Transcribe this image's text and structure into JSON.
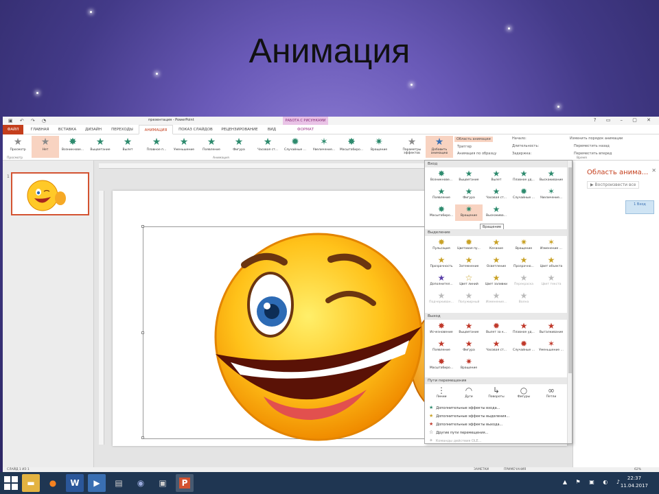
{
  "slide": {
    "title": "Анимация"
  },
  "window": {
    "doc_title": "презентация - PowerPoint",
    "context_group": "РАБОТА С РИСУНКАМИ",
    "qat_icons": [
      "save-icon",
      "undo-icon",
      "redo-icon",
      "start-icon"
    ]
  },
  "tabs": [
    {
      "label": "ФАЙЛ"
    },
    {
      "label": "ГЛАВНАЯ"
    },
    {
      "label": "ВСТАВКА"
    },
    {
      "label": "ДИЗАЙН"
    },
    {
      "label": "ПЕРЕХОДЫ"
    },
    {
      "label": "АНИМАЦИЯ"
    },
    {
      "label": "ПОКАЗ СЛАЙДОВ"
    },
    {
      "label": "РЕЦЕНЗИРОВАНИЕ"
    },
    {
      "label": "ВИД"
    },
    {
      "label": "ФОРМАТ"
    }
  ],
  "ribbon": {
    "preview": "Просмотр",
    "effects": [
      "Нет",
      "Возникнове...",
      "Выцветание",
      "Вылет",
      "Плавное п...",
      "Уменьшение",
      "Появление",
      "Фигура",
      "Часовая ст...",
      "Случайные ...",
      "Увеличение...",
      "Масштабиро...",
      "Вращение"
    ],
    "effect_params": "Параметры эффектов",
    "add_animation": "Добавить анимацию",
    "animation_pane": "Область анимации",
    "trigger": "Триггер",
    "painter": "Анимация по образцу",
    "start": "Начало:",
    "duration": "Длительность:",
    "delay": "Задержка:",
    "reorder_title": "Изменить порядок анимации",
    "move_earlier": "Переместить назад",
    "move_later": "Переместить вперед",
    "group_preview": "Просмотр",
    "group_animation": "Анимация",
    "group_timing": "Время"
  },
  "thumbnail": {
    "number": "1"
  },
  "gallery": {
    "sections": {
      "entrance": "Вход",
      "emphasis": "Выделение",
      "exit": "Выход",
      "path": "Пути перемещения"
    },
    "entrance": [
      "Возникнове...",
      "Выцветание",
      "Вылет",
      "Плавное уд...",
      "Выскакивание",
      "Появление",
      "Фигура",
      "Часовая ст...",
      "Случайные ...",
      "Увеличение...",
      "Масштабиро...",
      "Вращение",
      "Выскакива..."
    ],
    "emphasis": [
      "Пульсация",
      "Цветовая пу...",
      "Качание",
      "Вращение",
      "Изменение ...",
      "Прозрачность",
      "Затемнение",
      "Осветление",
      "Прозрачно...",
      "Цвет объекта",
      "Дополнител...",
      "Цвет линий",
      "Цвет заливки",
      "Перекраска",
      "Цвет текста",
      "Подчеркиван...",
      "Полужирный",
      "Изменение...",
      "Волна"
    ],
    "exit": [
      "Исчезновение",
      "Выцветание",
      "Вылет за к...",
      "Плавное уд...",
      "Выталкивание",
      "Появление",
      "Фигура",
      "Часовая ст...",
      "Случайные ...",
      "Уменьшение ...",
      "Масштабиро...",
      "Вращение"
    ],
    "path": [
      "Линии",
      "Дуги",
      "Повороты",
      "Фигуры",
      "Петли"
    ],
    "more": [
      "Дополнительные эффекты входа...",
      "Дополнительные эффекты выделения...",
      "Дополнительные эффекты выхода...",
      "Другие пути перемещения...",
      "Команды действия OLE..."
    ],
    "tooltip": "Вращение"
  },
  "anim_pane": {
    "title": "Область анима...",
    "play_from": "Воспроизвести все",
    "mini_label": "1 Вход"
  },
  "status": {
    "left": "СЛАЙД 1 ИЗ 1",
    "notes": "ЗАМЕТКИ",
    "comments": "ПРИМЕЧАНИЯ",
    "zoom": "62%"
  },
  "taskbar": {
    "apps": [
      "explorer-icon",
      "firefox-icon",
      "word-icon",
      "media-icon",
      "folder-icon",
      "network-icon",
      "vm-icon",
      "powerpoint-icon"
    ],
    "time": "22:37",
    "date": "11.04.2017"
  },
  "colors": {
    "accent": "#c43e1c",
    "entrance": "#2e8b6e",
    "emphasis": "#c9a227",
    "exit": "#c0392b"
  }
}
